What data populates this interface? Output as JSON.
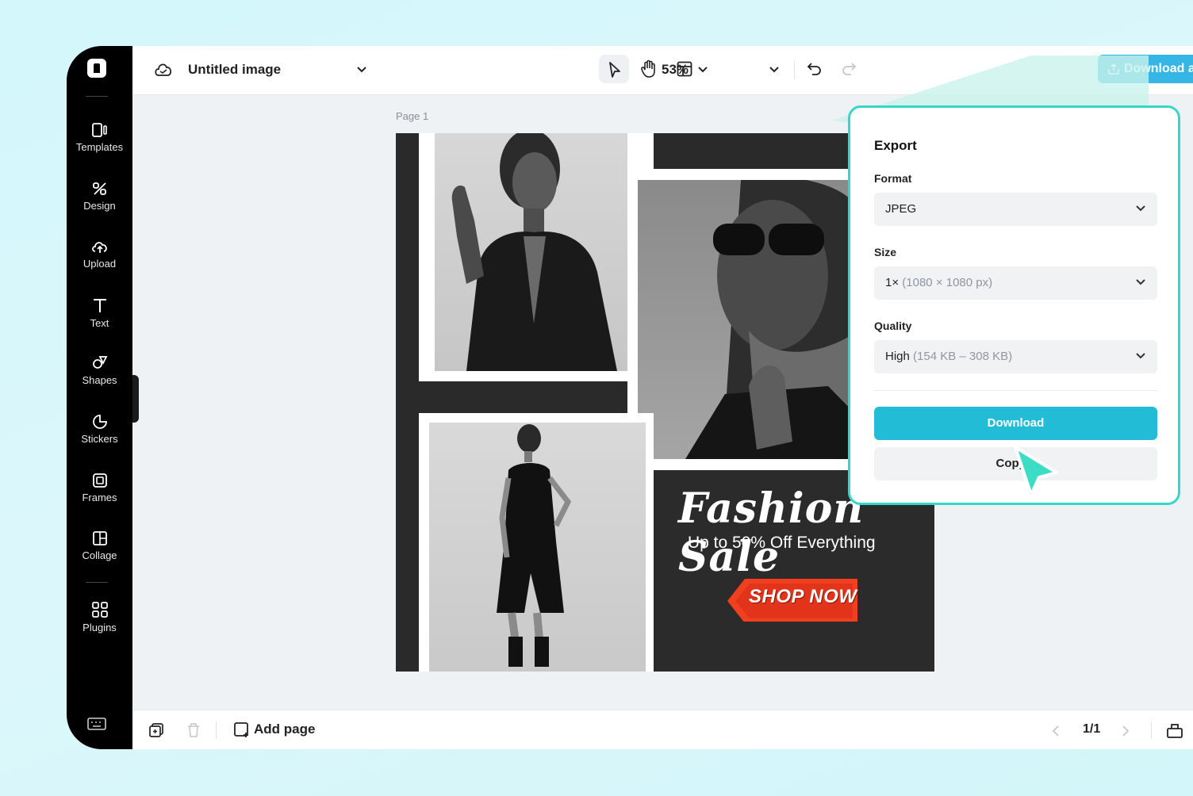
{
  "topbar": {
    "doc_title": "Untitled image",
    "zoom": "53%",
    "download_all": "Download all"
  },
  "sidebar": {
    "items": [
      {
        "label": "Templates",
        "icon": "templates-icon"
      },
      {
        "label": "Design",
        "icon": "design-icon"
      },
      {
        "label": "Upload",
        "icon": "upload-icon"
      },
      {
        "label": "Text",
        "icon": "text-icon"
      },
      {
        "label": "Shapes",
        "icon": "shapes-icon"
      },
      {
        "label": "Stickers",
        "icon": "stickers-icon"
      },
      {
        "label": "Frames",
        "icon": "frames-icon"
      },
      {
        "label": "Collage",
        "icon": "collage-icon"
      },
      {
        "label": "Plugins",
        "icon": "plugins-icon"
      }
    ]
  },
  "canvas": {
    "page_label": "Page 1",
    "design": {
      "headline": "Fashion Sale",
      "subline": "Up to 50% Off Everything",
      "cta": "SHOP NOW"
    }
  },
  "bottombar": {
    "add_page": "Add page",
    "page_count": "1/1"
  },
  "export": {
    "title": "Export",
    "format_label": "Format",
    "format_value": "JPEG",
    "size_label": "Size",
    "size_value": "1×",
    "size_detail": "(1080 × 1080 px)",
    "quality_label": "Quality",
    "quality_value": "High",
    "quality_detail": "(154 KB – 308 KB)",
    "download_label": "Download",
    "copy_label": "Copy a"
  },
  "colors": {
    "accent_button": "#35b6e4",
    "download_primary": "#22bcd6",
    "panel_border": "#37d7c7",
    "cta_red": "#f0401f"
  }
}
